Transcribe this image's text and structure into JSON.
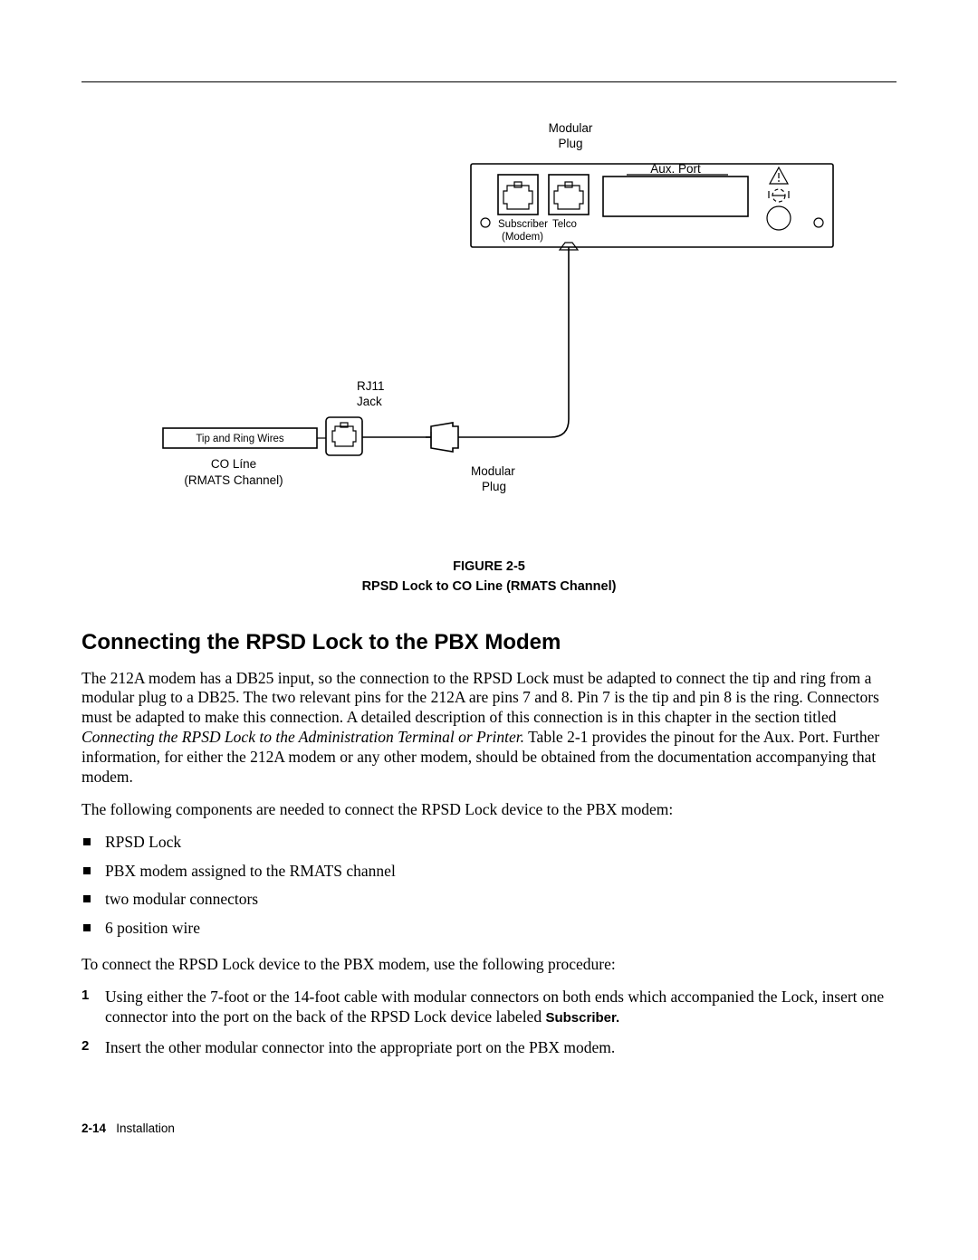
{
  "figure": {
    "top_label_1": "Modular",
    "top_label_2": "Plug",
    "device_port1_1": "Subscriber",
    "device_port1_2": "(Modem)",
    "device_port2": "Telco",
    "device_aux": "Aux. Port",
    "rj11_1": "RJ11",
    "rj11_2": "Jack",
    "tip_ring": "Tip and Ring Wires",
    "co_line": "CO Líne",
    "rmats": "(RMATS  Channel)",
    "bottom_label_1": "Modular",
    "bottom_label_2": "Plug",
    "caption_line1": "FIGURE 2-5",
    "caption_line2": "RPSD Lock to CO Line (RMATS Channel)"
  },
  "section": {
    "title": "Connecting the RPSD Lock to the PBX Modem",
    "para1_a": "The 212A modem has a DB25 input, so the connection to the RPSD Lock must be adapted to connect the tip and ring from a modular plug to a DB25. The two relevant pins for the 212A are pins 7 and 8. Pin 7 is the tip and pin 8 is the ring. Connectors must be adapted to make this connection. A detailed description of this connection is in this chapter in the section titled ",
    "para1_italic": "Connecting the RPSD Lock to the Administration Terminal or Printer.",
    "para1_b": " Table 2-1 provides the pinout for the Aux. Port. Further information, for either the 212A modem or any other modem, should be obtained from the documentation accompanying that modem.",
    "para2": "The following components are needed to connect the RPSD Lock device to the PBX modem:",
    "bullets": [
      "RPSD Lock",
      "PBX modem assigned to the RMATS channel",
      "two modular connectors",
      "6 position wire"
    ],
    "para3": "To connect the RPSD Lock device to the PBX modem, use the following procedure:",
    "step1_a": "Using either the 7-foot or the 14-foot cable with modular connectors on both ends which accompanied the Lock, insert one connector into the port on the back of the RPSD Lock device labeled ",
    "step1_bold": "Subscriber.",
    "step2": "Insert the other modular connector into the appropriate port on the PBX modem."
  },
  "footer": {
    "page": "2-14",
    "label": "Installation"
  }
}
